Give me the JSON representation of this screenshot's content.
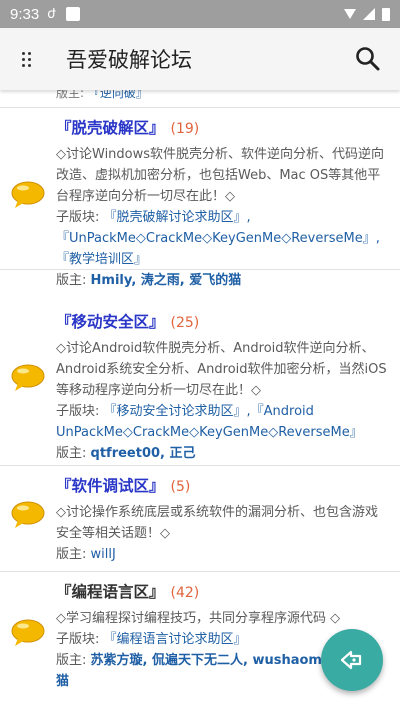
{
  "status_bar": {
    "time": "9:33",
    "notif_glyph": "ժ",
    "icons": [
      "wifi-icon",
      "signal-icon",
      "battery-icon"
    ]
  },
  "toolbar": {
    "title": "吾爱破解论坛",
    "menu_icon": "menu-dots-icon",
    "search_icon": "search-icon"
  },
  "prev_item_sliver": {
    "label": "版主:",
    "link": "『逆向破』"
  },
  "forums": [
    {
      "title": "『脱壳破解区』",
      "count": "(19)",
      "description": "◇讨论Windows软件脱壳分析、软件逆向分析、代码逆向改造、虚拟机加密分析，也包括Web、Mac OS等其他平台程序逆向分析一切尽在此！◇",
      "sub_label": "子版块:",
      "sub_line1": "『脱壳破解讨论求助区』,",
      "sub_line2": "『UnPackMe◇CrackMe◇KeyGenMe◇ReverseMe』,",
      "sub_line3": "『教学培训区』",
      "mods_label": "版主:",
      "mods": "Hmily, 涛之雨, 爱飞的猫"
    },
    {
      "title": "『移动安全区』",
      "count": "(25)",
      "description": "◇讨论Android软件脱壳分析、Android软件逆向分析、Android系统安全分析、Android软件加密分析，当然iOS等移动程序逆向分析一切尽在此！◇",
      "sub_label": "子版块:",
      "sub_line1": "『移动安全讨论求助区』,『Android",
      "sub_line2": "UnPackMe◇CrackMe◇KeyGenMe◇ReverseMe』",
      "mods_label": "版主:",
      "mods": "qtfreet00, 正己"
    },
    {
      "title": "『软件调试区』",
      "count": "(5)",
      "description": "◇讨论操作系统底层或系统软件的漏洞分析、也包含游戏安全等相关话题！◇",
      "mods_label": "版主:",
      "mods": "willJ"
    },
    {
      "title": "『编程语言区』",
      "count": "(42)",
      "description": "◇学习编程探讨编程技巧，共同分享程序源代码 ◇",
      "sub_label": "子版块:",
      "sub_line1": "『编程语言讨论求助区』",
      "mods_label": "版主:",
      "mods_line1": "苏紫方璇, 侃遍天下无二人, wushaomink",
      "mods_line2": "猫"
    }
  ],
  "fab": {
    "icon": "back-arrow-icon"
  },
  "colors": {
    "status_bar": "#9e9e9e",
    "toolbar": "#f5f5f5",
    "forum_title": "#2a36c8",
    "count": "#e0643c",
    "link": "#1f5fa5",
    "fab": "#3aaba3",
    "bubble": "#f5b800"
  }
}
